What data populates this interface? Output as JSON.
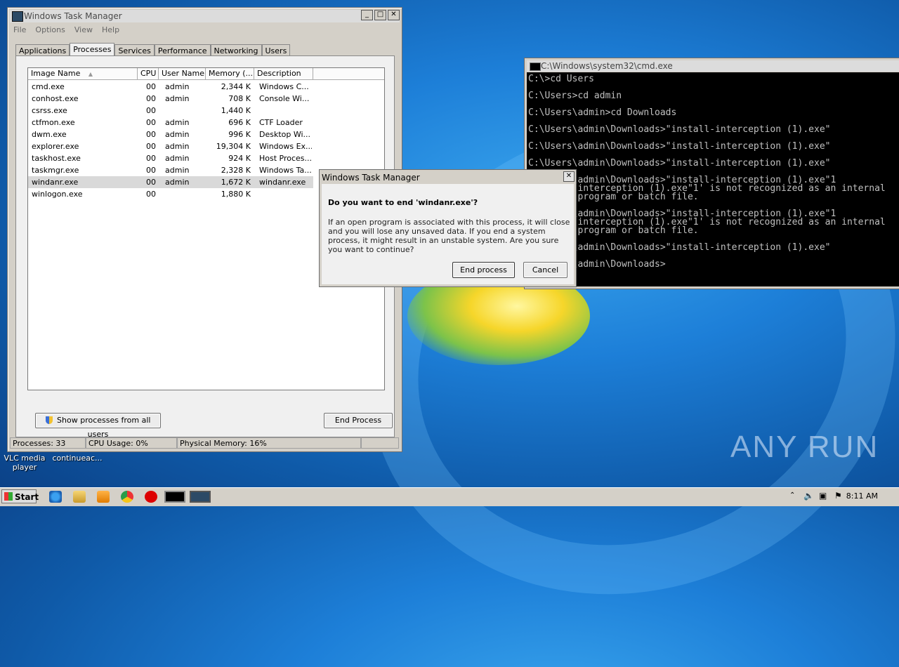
{
  "taskmgr": {
    "title": "Windows Task Manager",
    "menu": [
      "File",
      "Options",
      "View",
      "Help"
    ],
    "tabs": [
      "Applications",
      "Processes",
      "Services",
      "Performance",
      "Networking",
      "Users"
    ],
    "active_tab": "Processes",
    "columns": [
      "Image Name",
      "CPU",
      "User Name",
      "Memory (...",
      "Description"
    ],
    "rows": [
      {
        "name": "cmd.exe",
        "cpu": "00",
        "user": "admin",
        "mem": "2,344 K",
        "desc": "Windows C..."
      },
      {
        "name": "conhost.exe",
        "cpu": "00",
        "user": "admin",
        "mem": "708 K",
        "desc": "Console Wi..."
      },
      {
        "name": "csrss.exe",
        "cpu": "00",
        "user": "",
        "mem": "1,440 K",
        "desc": ""
      },
      {
        "name": "ctfmon.exe",
        "cpu": "00",
        "user": "admin",
        "mem": "696 K",
        "desc": "CTF Loader"
      },
      {
        "name": "dwm.exe",
        "cpu": "00",
        "user": "admin",
        "mem": "996 K",
        "desc": "Desktop Wi..."
      },
      {
        "name": "explorer.exe",
        "cpu": "00",
        "user": "admin",
        "mem": "19,304 K",
        "desc": "Windows Ex..."
      },
      {
        "name": "taskhost.exe",
        "cpu": "00",
        "user": "admin",
        "mem": "924 K",
        "desc": "Host Proces..."
      },
      {
        "name": "taskmgr.exe",
        "cpu": "00",
        "user": "admin",
        "mem": "2,328 K",
        "desc": "Windows Ta..."
      },
      {
        "name": "windanr.exe",
        "cpu": "00",
        "user": "admin",
        "mem": "1,672 K",
        "desc": "windanr.exe"
      },
      {
        "name": "winlogon.exe",
        "cpu": "00",
        "user": "",
        "mem": "1,880 K",
        "desc": ""
      }
    ],
    "selected_row": "windanr.exe",
    "show_all_label": "Show processes from all users",
    "end_process_label": "End Process",
    "status": {
      "processes": "Processes: 33",
      "cpu": "CPU Usage: 0%",
      "memory": "Physical Memory: 16%"
    }
  },
  "cmd": {
    "title": "C:\\Windows\\system32\\cmd.exe",
    "lines": [
      "C:\\>cd Users",
      "",
      "C:\\Users>cd admin",
      "",
      "C:\\Users\\admin>cd Downloads",
      "",
      "C:\\Users\\admin\\Downloads>\"install-interception (1).exe\"",
      "",
      "C:\\Users\\admin\\Downloads>\"install-interception (1).exe\"",
      "",
      "C:\\Users\\admin\\Downloads>\"install-interception (1).exe\"",
      "",
      "C:\\Users\\admin\\Downloads>\"install-interception (1).exe\"1",
      "'install-interception (1).exe\"1' is not recognized as an internal",
      "operable program or batch file.",
      "",
      "C:\\Users\\admin\\Downloads>\"install-interception (1).exe\"1",
      "'install-interception (1).exe\"1' is not recognized as an internal",
      "operable program or batch file.",
      "",
      "C:\\Users\\admin\\Downloads>\"install-interception (1).exe\"",
      "",
      "C:\\Users\\admin\\Downloads>"
    ]
  },
  "dialog": {
    "title": "Windows Task Manager",
    "question": "Do you want to end 'windanr.exe'?",
    "message": "If an open program is associated with this process, it will close and you will lose any unsaved data. If you end a system process, it might result in an unstable system. Are you sure you want to continue?",
    "end_button": "End process",
    "cancel_button": "Cancel"
  },
  "desktop": {
    "icon1_label": "VLC media player",
    "icon2_label": "continueac...",
    "watermark": "ANY RUN"
  },
  "taskbar": {
    "start_label": "Start",
    "clock": "8:11 AM",
    "pinned": [
      "ie-icon",
      "explorer-icon",
      "media-player-icon",
      "chrome-icon",
      "opera-icon",
      "cmd-icon",
      "taskmgr-icon"
    ]
  }
}
